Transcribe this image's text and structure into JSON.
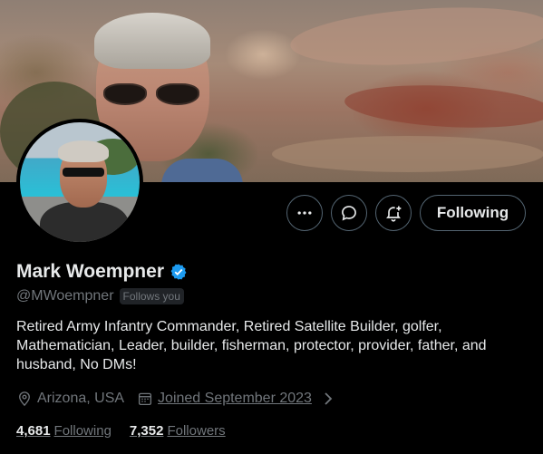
{
  "profile": {
    "display_name": "Mark Woempner",
    "handle": "@MWoempner",
    "follows_you_badge": "Follows you",
    "bio": "Retired Army Infantry Commander, Retired Satellite Builder, golfer, Mathematician, Leader, builder, fisherman, protector, provider, father, and husband, No DMs!",
    "location": "Arizona, USA",
    "joined": "Joined September 2023",
    "verified": true
  },
  "actions": {
    "more_icon": "more-horizontal-icon",
    "message_icon": "message-bubble-icon",
    "notify_icon": "bell-plus-icon",
    "follow_label": "Following"
  },
  "stats": {
    "following_count": "4,681",
    "following_label": "Following",
    "followers_count": "7,352",
    "followers_label": "Followers"
  },
  "colors": {
    "background": "#000000",
    "text_primary": "#e7e9ea",
    "text_secondary": "#71767b",
    "border": "#536471",
    "verified_badge": "#1d9bf0"
  }
}
